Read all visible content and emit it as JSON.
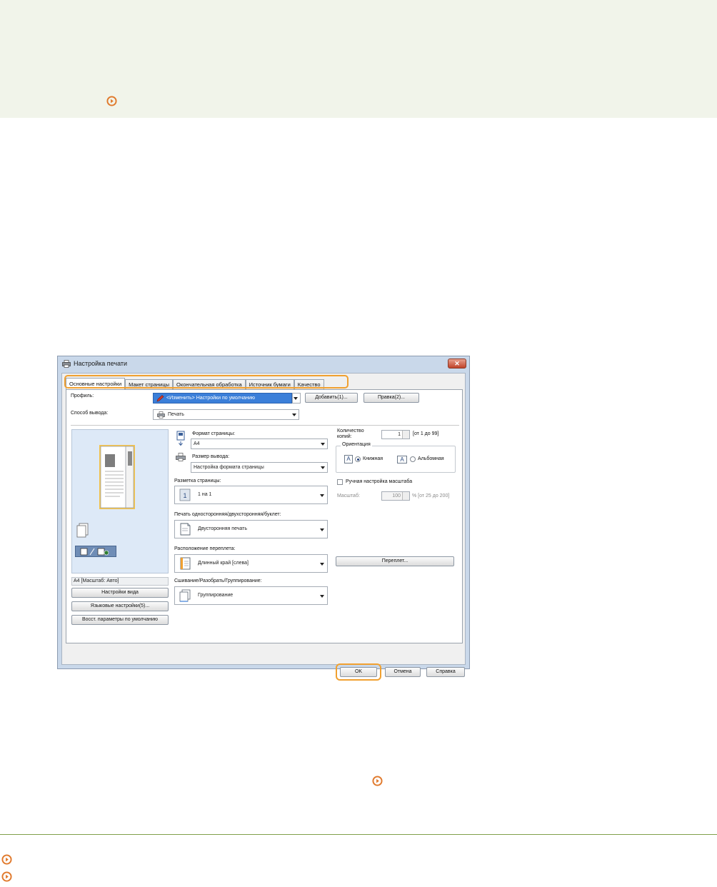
{
  "dialog": {
    "title": "Настройка печати",
    "close_label": "✕",
    "tabs": [
      "Основные настройки",
      "Макет страницы",
      "Окончательная обработка",
      "Источник бумаги",
      "Качество"
    ],
    "profile": {
      "label": "Профиль:",
      "value": "<Изменить> Настройки по умолчанию",
      "add_button": "Добавить(1)...",
      "edit_button": "Правка(2)..."
    },
    "output_method": {
      "label": "Способ вывода:",
      "value": "Печать"
    },
    "page_size": {
      "label": "Формат страницы:",
      "value": "A4"
    },
    "output_size": {
      "label": "Размер вывода:",
      "value": "Настройка формата страницы"
    },
    "page_layout": {
      "label": "Разметка страницы:",
      "value": "1 на 1"
    },
    "duplex": {
      "label": "Печать односторонняя/двухсторонняя/буклет:",
      "value": "Двусторонняя печать"
    },
    "binding": {
      "label": "Расположение переплета:",
      "value": "Длинный край [слева]",
      "button": "Переплет..."
    },
    "collate": {
      "label": "Сшивание/Разобрать/Группирование:",
      "value": "Группирование"
    },
    "copies": {
      "label_line1": "Количество",
      "label_line2": "копий:",
      "value": "1",
      "range": "[от 1 до 99]"
    },
    "orientation": {
      "label": "Ориентация",
      "portrait": "Книжная",
      "landscape": "Альбомная",
      "selected": "portrait"
    },
    "manual_scale": {
      "label": "Ручная настройка масштаба",
      "scale_label": "Масштаб:",
      "value": "100",
      "range": "% [от 25 до 200]"
    },
    "preview_status": "A4 [Масштаб: Авто]",
    "left_buttons": [
      "Настройки вида",
      "Языковые настройки(5)...",
      "Восст. параметры по умолчанию"
    ],
    "footer_buttons": {
      "ok": "OK",
      "cancel": "Отмена",
      "help": "Справка"
    }
  },
  "icons": [
    "arrow-circle-icon"
  ],
  "colors": {
    "accent_orange": "#f0a030",
    "note_bg": "#f1f4ea",
    "rule_green": "#7fa04a",
    "selection_blue": "#3b7fd9"
  }
}
